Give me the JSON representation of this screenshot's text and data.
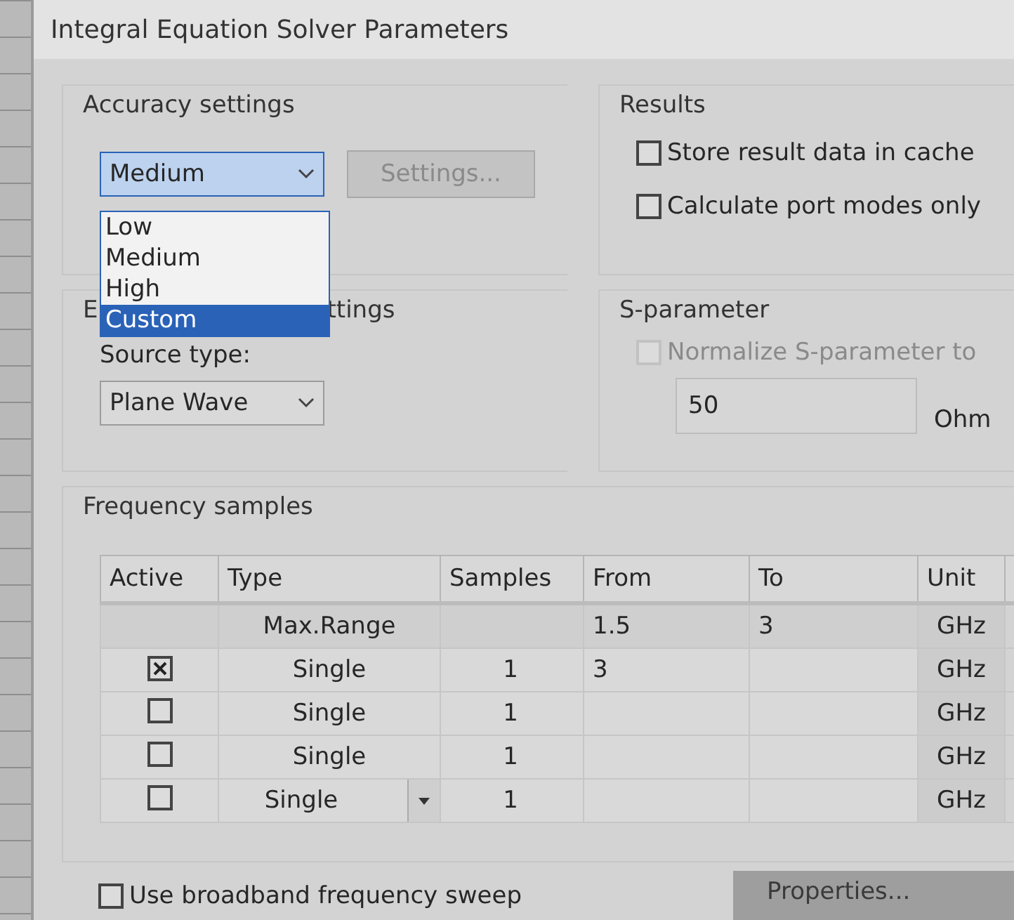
{
  "window": {
    "title": "Integral Equation Solver Parameters"
  },
  "accuracy": {
    "title": "Accuracy settings",
    "combo": {
      "value": "Medium",
      "expanded": true,
      "options": [
        {
          "label": "Low",
          "highlighted": false
        },
        {
          "label": "Medium",
          "highlighted": false
        },
        {
          "label": "High",
          "highlighted": false
        },
        {
          "label": "Custom",
          "highlighted": true
        }
      ]
    },
    "settings_button": {
      "label": "Settings...",
      "disabled": true
    }
  },
  "excitation": {
    "title_parts": [
      "E",
      "ttings"
    ],
    "source_label": "Source type:",
    "source_combo": {
      "value": "Plane Wave"
    }
  },
  "results": {
    "title": "Results",
    "options": [
      {
        "label": "Store result data in cache",
        "checked": false
      },
      {
        "label": "Calculate port modes only",
        "checked": false
      }
    ]
  },
  "s_parameter": {
    "title": "S-parameter",
    "normalize": {
      "label": "Normalize S-parameter to",
      "checked": false,
      "disabled": true
    },
    "impedance": {
      "value": "50",
      "unit": "Ohm"
    }
  },
  "frequency": {
    "title": "Frequency samples",
    "columns": [
      "Active",
      "Type",
      "Samples",
      "From",
      "To",
      "Unit"
    ],
    "rows": [
      {
        "kind": "range",
        "type": "Max.Range",
        "samples": "",
        "from": "1.5",
        "to": "3",
        "unit": "GHz"
      },
      {
        "kind": "single",
        "active": true,
        "focused": false,
        "type": "Single",
        "samples": "1",
        "from": "3",
        "to": "",
        "unit": "GHz"
      },
      {
        "kind": "single",
        "active": false,
        "focused": false,
        "type": "Single",
        "samples": "1",
        "from": "",
        "to": "",
        "unit": "GHz"
      },
      {
        "kind": "single",
        "active": false,
        "focused": false,
        "type": "Single",
        "samples": "1",
        "from": "",
        "to": "",
        "unit": "GHz"
      },
      {
        "kind": "single",
        "active": false,
        "focused": true,
        "type": "Single",
        "samples": "1",
        "from": "",
        "to": "",
        "unit": "GHz"
      }
    ]
  },
  "broadband": {
    "label": "Use broadband frequency sweep",
    "checked": false
  },
  "properties_button": {
    "label": "Properties..."
  }
}
